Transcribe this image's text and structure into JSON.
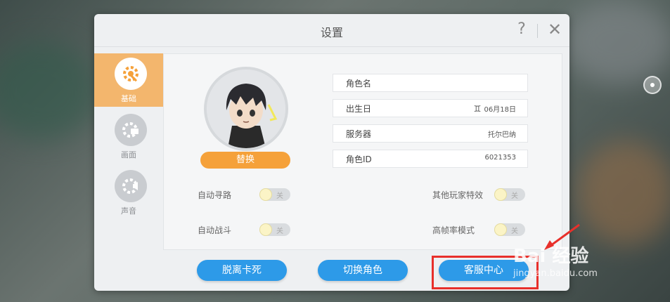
{
  "dialog": {
    "title": "设置",
    "help_icon": "question-mark-icon",
    "close_icon": "close-icon"
  },
  "sidebar": {
    "items": [
      {
        "label": "基础",
        "icon": "gear-wrench-icon",
        "active": true
      },
      {
        "label": "画面",
        "icon": "gear-monitor-icon",
        "active": false
      },
      {
        "label": "声音",
        "icon": "gear-speaker-icon",
        "active": false
      }
    ]
  },
  "profile": {
    "swap_label": "替换",
    "info": [
      {
        "label": "角色名",
        "value": ""
      },
      {
        "label": "出生日",
        "value": "06月18日",
        "icon": "gemini-icon"
      },
      {
        "label": "服务器",
        "value": "托尔巴纳"
      },
      {
        "label": "角色ID",
        "value": "6021353"
      }
    ]
  },
  "toggles": [
    {
      "label": "自动寻路",
      "state": "关"
    },
    {
      "label": "自动战斗",
      "state": "关"
    },
    {
      "label": "其他玩家特效",
      "state": "关"
    },
    {
      "label": "高帧率模式",
      "state": "关"
    }
  ],
  "actions": {
    "unstuck": "脱离卡死",
    "switch_role": "切换角色",
    "customer_service": "客服中心"
  },
  "watermark": {
    "text": "Bai 经验",
    "sub": "jingyan.baidu.com"
  },
  "colors": {
    "accent_orange": "#f5a13a",
    "sidebar_active": "#f3b66d",
    "button_blue": "#2d9ae8",
    "highlight_red": "#e8302b"
  }
}
